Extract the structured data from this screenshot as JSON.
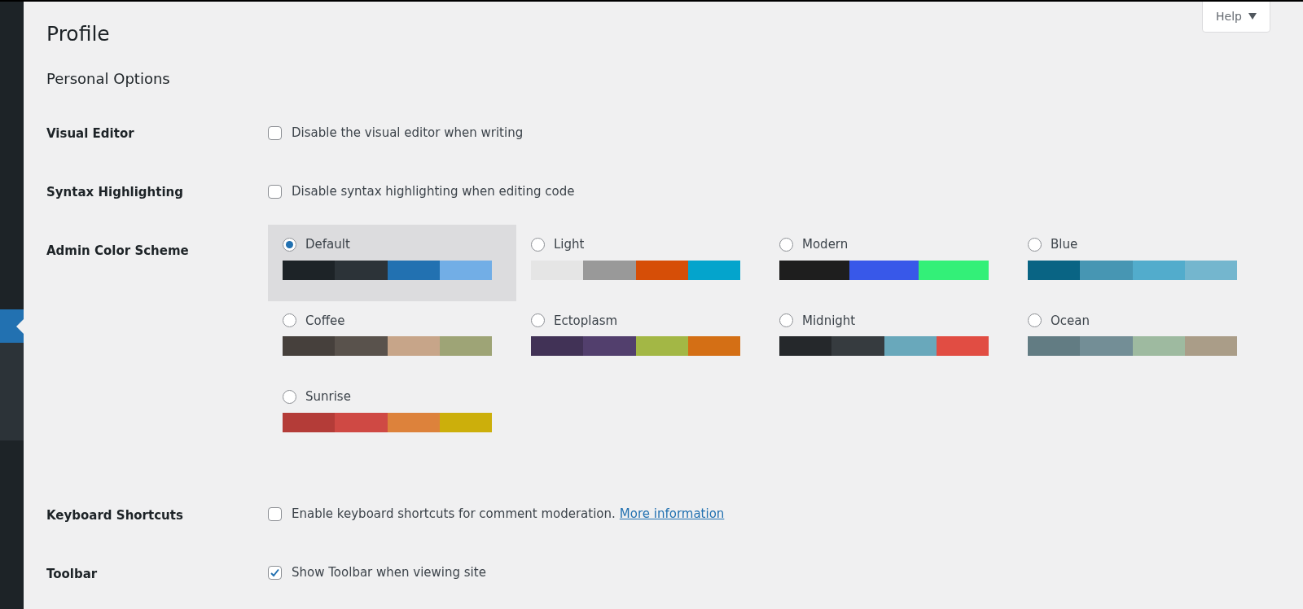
{
  "sidebar": {
    "active_marker": true
  },
  "help_button": {
    "label": "Help",
    "expanded": false
  },
  "title": "Profile",
  "section_title": "Personal Options",
  "rows": [
    {
      "kind": "checkbox",
      "label": "Visual Editor",
      "text": "Disable the visual editor when writing",
      "checked": false
    },
    {
      "kind": "checkbox",
      "label": "Syntax Highlighting",
      "text": "Disable syntax highlighting when editing code",
      "checked": false
    },
    {
      "kind": "color_scheme",
      "label": "Admin Color Scheme",
      "schemes": [
        {
          "name": "Default",
          "selected": true,
          "swatches": [
            {
              "color": "#1d2327"
            },
            {
              "color": "#2c3338"
            },
            {
              "color": "#2271b1"
            },
            {
              "color": "#72aee6"
            }
          ]
        },
        {
          "name": "Light",
          "selected": false,
          "swatches": [
            {
              "color": "#e5e5e5"
            },
            {
              "color": "#999999"
            },
            {
              "color": "#d64e07"
            },
            {
              "color": "#04a4cc"
            }
          ]
        },
        {
          "name": "Modern",
          "selected": false,
          "swatches": [
            {
              "color": "#1e1e1e"
            },
            {
              "color": "#3858e9"
            },
            {
              "color": "#33f078"
            }
          ]
        },
        {
          "name": "Blue",
          "selected": false,
          "swatches": [
            {
              "color": "#096484"
            },
            {
              "color": "#4796b3"
            },
            {
              "color": "#52accc"
            },
            {
              "color": "#74b6ce"
            }
          ]
        },
        {
          "name": "Coffee",
          "selected": false,
          "swatches": [
            {
              "color": "#46403c"
            },
            {
              "color": "#59524c"
            },
            {
              "color": "#c7a589"
            },
            {
              "color": "#9ea476"
            }
          ]
        },
        {
          "name": "Ectoplasm",
          "selected": false,
          "swatches": [
            {
              "color": "#413256"
            },
            {
              "color": "#523f6d"
            },
            {
              "color": "#a3b745"
            },
            {
              "color": "#d46f15"
            }
          ]
        },
        {
          "name": "Midnight",
          "selected": false,
          "swatches": [
            {
              "color": "#25282b"
            },
            {
              "color": "#363b3f"
            },
            {
              "color": "#69a8bb"
            },
            {
              "color": "#e14d43"
            }
          ]
        },
        {
          "name": "Ocean",
          "selected": false,
          "swatches": [
            {
              "color": "#627c83"
            },
            {
              "color": "#738e96"
            },
            {
              "color": "#9ebaa0"
            },
            {
              "color": "#aa9d88"
            }
          ]
        },
        {
          "name": "Sunrise",
          "selected": false,
          "swatches": [
            {
              "color": "#b43c38"
            },
            {
              "color": "#cf4944"
            },
            {
              "color": "#dd823b"
            },
            {
              "color": "#ccaf0b"
            }
          ]
        }
      ]
    },
    {
      "kind": "checkbox",
      "label": "Keyboard Shortcuts",
      "text": "Enable keyboard shortcuts for comment moderation.",
      "link": "More information",
      "checked": false
    },
    {
      "kind": "checkbox",
      "label": "Toolbar",
      "text": "Show Toolbar when viewing site",
      "checked": true
    }
  ]
}
